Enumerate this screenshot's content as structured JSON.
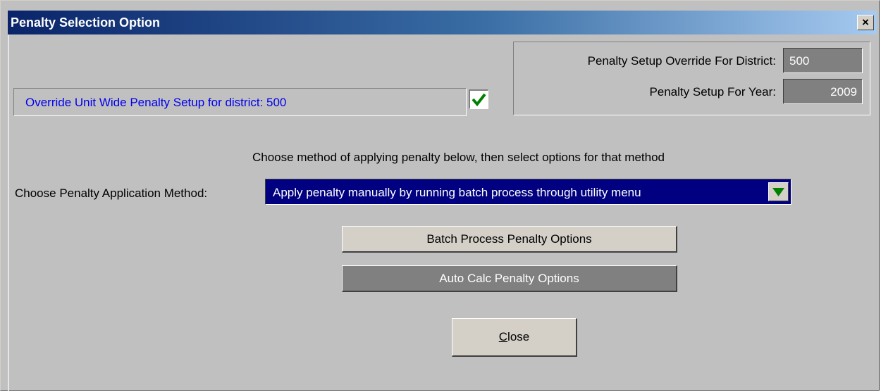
{
  "window": {
    "title": "Penalty Selection Option",
    "close_glyph": "×"
  },
  "override": {
    "label": "Override Unit Wide Penalty Setup for district: 500",
    "checked": true,
    "check_color": "#008000"
  },
  "setup": {
    "district_label": "Penalty Setup Override For District:",
    "district_value": "500",
    "year_label": "Penalty Setup For Year:",
    "year_value": "2009"
  },
  "method": {
    "instruction": "Choose method of applying penalty below, then select options for that method",
    "label": "Choose Penalty Application Method:",
    "selected": "Apply penalty manually by running batch process through utility menu",
    "dropdown_icon": "triangle-down-icon",
    "dropdown_icon_color": "#008000"
  },
  "buttons": {
    "batch": "Batch Process Penalty Options",
    "auto_calc": "Auto Calc Penalty Options",
    "close_accel": "C",
    "close_rest": "lose"
  },
  "colors": {
    "title_start": "#0a246a",
    "title_end": "#a6caf0",
    "dialog_bg": "#c0c0c0",
    "selection_bg": "#000080",
    "link_text": "#0000ee"
  }
}
